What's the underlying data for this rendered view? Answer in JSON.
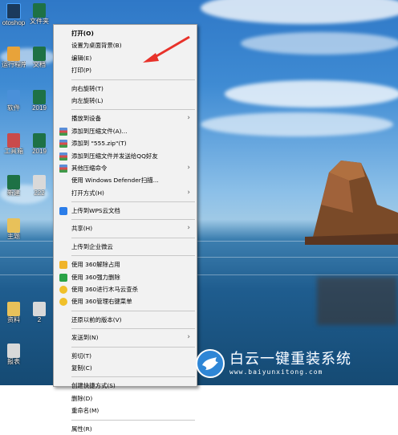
{
  "desktop": {
    "icons": [
      {
        "caption": "otoshop",
        "icon": "photoshop-icon",
        "color": "#1b3a5c"
      },
      {
        "caption": "文件夹",
        "icon": "excel-icon",
        "color": "#1e7145"
      },
      {
        "caption": "运行程序",
        "icon": "app-icon",
        "color": "#e8a33a"
      },
      {
        "caption": "文档",
        "icon": "excel-icon",
        "color": "#1e7145"
      },
      {
        "caption": "软件",
        "icon": "app-icon",
        "color": "#4a90d9"
      },
      {
        "caption": "2019",
        "icon": "excel-icon",
        "color": "#1e7145"
      },
      {
        "caption": "工具箱",
        "icon": "app-icon",
        "color": "#c94b4b"
      },
      {
        "caption": "2019",
        "icon": "excel-icon",
        "color": "#1e7145"
      },
      {
        "caption": "新建",
        "icon": "excel-icon",
        "color": "#1e7145"
      },
      {
        "caption": "222",
        "icon": "document-icon",
        "color": "#d9d9d9"
      },
      {
        "caption": "主题",
        "icon": "folder-icon",
        "color": "#e8c15a"
      },
      {
        "caption": "资料",
        "icon": "folder-icon",
        "color": "#e8c15a"
      },
      {
        "caption": "2",
        "icon": "document-icon",
        "color": "#d9d9d9"
      },
      {
        "caption": "报表",
        "icon": "document-icon",
        "color": "#d9d9d9"
      }
    ]
  },
  "context_menu": {
    "items": [
      {
        "type": "item",
        "label": "打开(O)",
        "bold": true
      },
      {
        "type": "item",
        "label": "设置为桌面背景(B)"
      },
      {
        "type": "item",
        "label": "编辑(E)"
      },
      {
        "type": "item",
        "label": "打印(P)"
      },
      {
        "type": "sep"
      },
      {
        "type": "item",
        "label": "向右旋转(T)"
      },
      {
        "type": "item",
        "label": "向左旋转(L)"
      },
      {
        "type": "sep"
      },
      {
        "type": "item",
        "label": "播放到设备",
        "submenu": true
      },
      {
        "type": "item",
        "label": "添加到压缩文件(A)...",
        "icon": "winrar-icon"
      },
      {
        "type": "item",
        "label": "添加到 \"555.zip\"(T)",
        "icon": "winrar-icon"
      },
      {
        "type": "item",
        "label": "添加到压缩文件并发送给QQ好友",
        "icon": "winrar-icon"
      },
      {
        "type": "item",
        "label": "其他压缩命令",
        "icon": "winrar-icon",
        "submenu": true
      },
      {
        "type": "item",
        "label": "使用 Windows Defender扫描..."
      },
      {
        "type": "item",
        "label": "打开方式(H)",
        "submenu": true
      },
      {
        "type": "sep"
      },
      {
        "type": "item",
        "label": "上传到WPS云文档",
        "icon": "wps-cloud-icon"
      },
      {
        "type": "sep"
      },
      {
        "type": "item",
        "label": "共享(H)",
        "submenu": true
      },
      {
        "type": "sep"
      },
      {
        "type": "item",
        "label": "上传到企业微云"
      },
      {
        "type": "sep"
      },
      {
        "type": "item",
        "label": "使用 360解除占用",
        "icon": "360-unlock-icon"
      },
      {
        "type": "item",
        "label": "使用 360强力删除",
        "icon": "360-shred-icon"
      },
      {
        "type": "item",
        "label": "使用 360进行木马云查杀",
        "icon": "360-scan-icon"
      },
      {
        "type": "item",
        "label": "使用 360管理右键菜单",
        "icon": "360-manage-icon"
      },
      {
        "type": "sep"
      },
      {
        "type": "item",
        "label": "还原以前的版本(V)"
      },
      {
        "type": "sep"
      },
      {
        "type": "item",
        "label": "发送到(N)",
        "submenu": true
      },
      {
        "type": "sep"
      },
      {
        "type": "item",
        "label": "剪切(T)"
      },
      {
        "type": "item",
        "label": "复制(C)"
      },
      {
        "type": "sep"
      },
      {
        "type": "item",
        "label": "创建快捷方式(S)"
      },
      {
        "type": "item",
        "label": "删除(D)"
      },
      {
        "type": "item",
        "label": "重命名(M)"
      },
      {
        "type": "sep"
      },
      {
        "type": "item",
        "label": "属性(R)"
      }
    ]
  },
  "watermark": {
    "title": "白云一键重装系统",
    "url": "www.baiyunxitong.com"
  },
  "colors": {
    "menu_bg": "#f2f2f2",
    "arrow": "#e8322a",
    "watermark_blue": "#2e86d6"
  }
}
